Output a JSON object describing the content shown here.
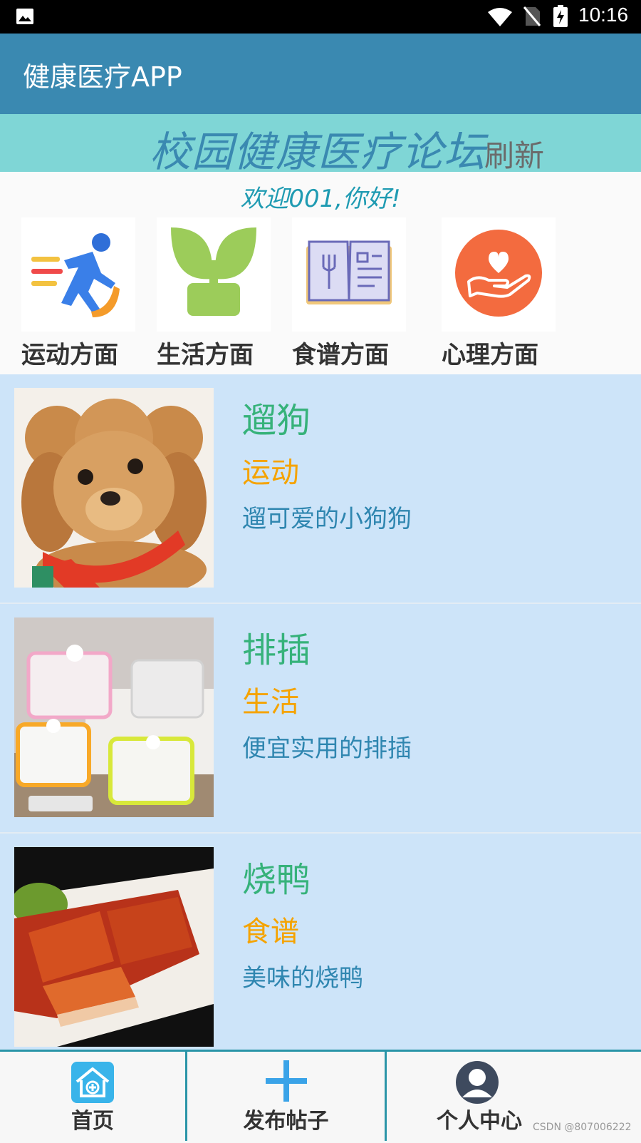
{
  "status_bar": {
    "time": "10:16"
  },
  "app_bar": {
    "title": "健康医疗APP"
  },
  "banner": {
    "title": "校园健康医疗论坛",
    "refresh_label": "刷新"
  },
  "welcome": "欢迎001,你好!",
  "categories": [
    {
      "label": "运动方面",
      "icon": "running-person-icon"
    },
    {
      "label": "生活方面",
      "icon": "sprout-icon"
    },
    {
      "label": "食谱方面",
      "icon": "recipe-book-icon"
    },
    {
      "label": "心理方面",
      "icon": "heart-hand-icon"
    }
  ],
  "posts": [
    {
      "name": "遛狗",
      "tag": "运动",
      "desc": "遛可爱的小狗狗",
      "image": "poodle-photo"
    },
    {
      "name": "排插",
      "tag": "生活",
      "desc": "便宜实用的排插",
      "image": "power-strip-photo"
    },
    {
      "name": "烧鸭",
      "tag": "食谱",
      "desc": "美味的烧鸭",
      "image": "roast-duck-photo"
    }
  ],
  "bottom_nav": [
    {
      "label": "首页",
      "icon": "home-icon"
    },
    {
      "label": "发布帖子",
      "icon": "plus-icon"
    },
    {
      "label": "个人中心",
      "icon": "user-avatar-icon"
    }
  ],
  "watermark": "CSDN @807006222",
  "colors": {
    "app_bar": "#3a89b1",
    "banner": "#7fd6d6",
    "list_background": "#cde4f9",
    "post_name": "#36b27a",
    "post_tag": "#f5a300",
    "post_desc": "#2f86b0",
    "nav_border": "#2a95a8"
  }
}
